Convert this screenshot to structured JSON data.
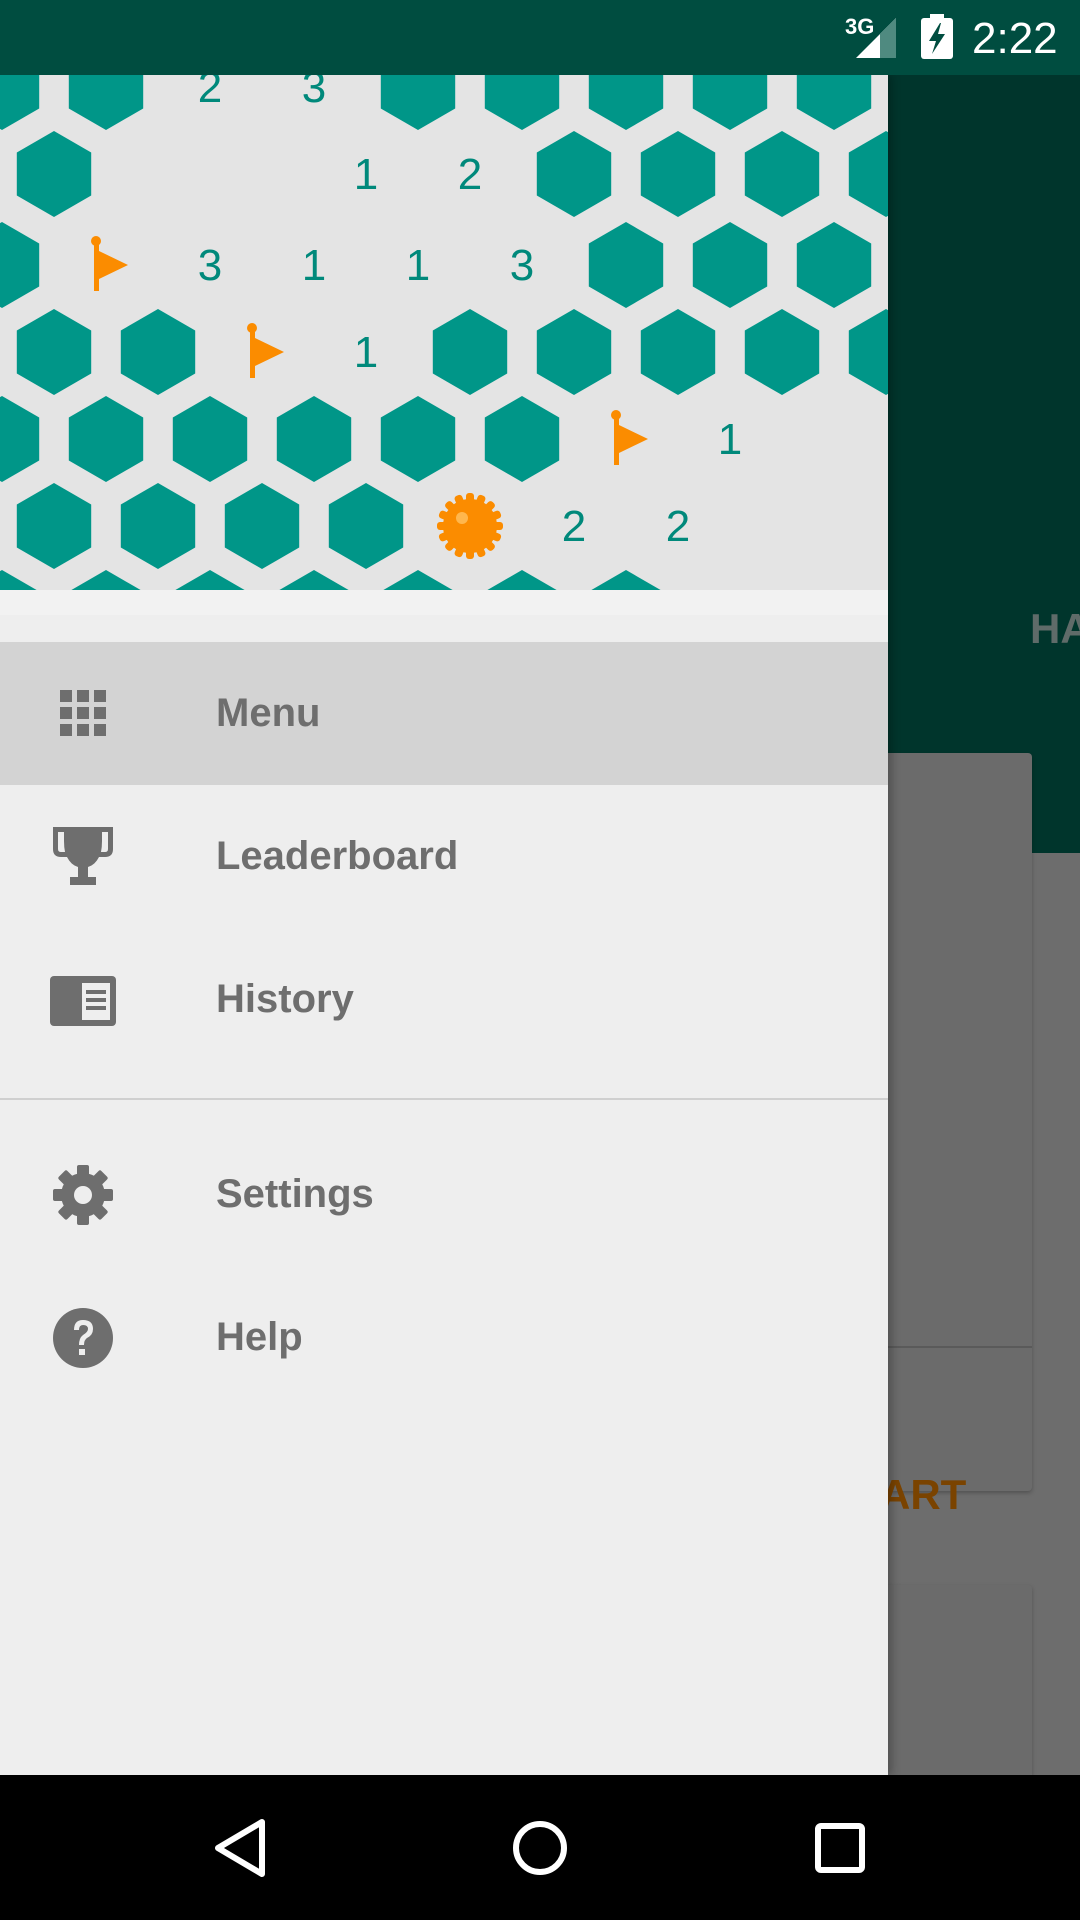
{
  "status_bar": {
    "network": "3G",
    "time": "2:22",
    "color": "#004d40"
  },
  "drawer": {
    "header_board": {
      "numbers": [
        "2",
        "3",
        "1",
        "2",
        "3",
        "1",
        "1",
        "3",
        "1",
        "1",
        "2",
        "2"
      ],
      "tile_color": "#009688",
      "revealed_color": "#e4e4e4",
      "flag_color": "#fb8c00",
      "number_color": "#00897b"
    },
    "items": [
      {
        "label": "Menu",
        "icon": "apps-grid-icon",
        "active": true
      },
      {
        "label": "Leaderboard",
        "icon": "trophy-icon",
        "active": false
      },
      {
        "label": "History",
        "icon": "history-icon",
        "active": false
      },
      {
        "label": "Settings",
        "icon": "gear-icon",
        "active": false
      },
      {
        "label": "Help",
        "icon": "help-icon",
        "active": false
      }
    ]
  },
  "background_app": {
    "tab_label": "HA",
    "card_action": "ART"
  },
  "nav_bar": {
    "buttons": [
      "back-icon",
      "home-icon",
      "recents-icon"
    ]
  }
}
